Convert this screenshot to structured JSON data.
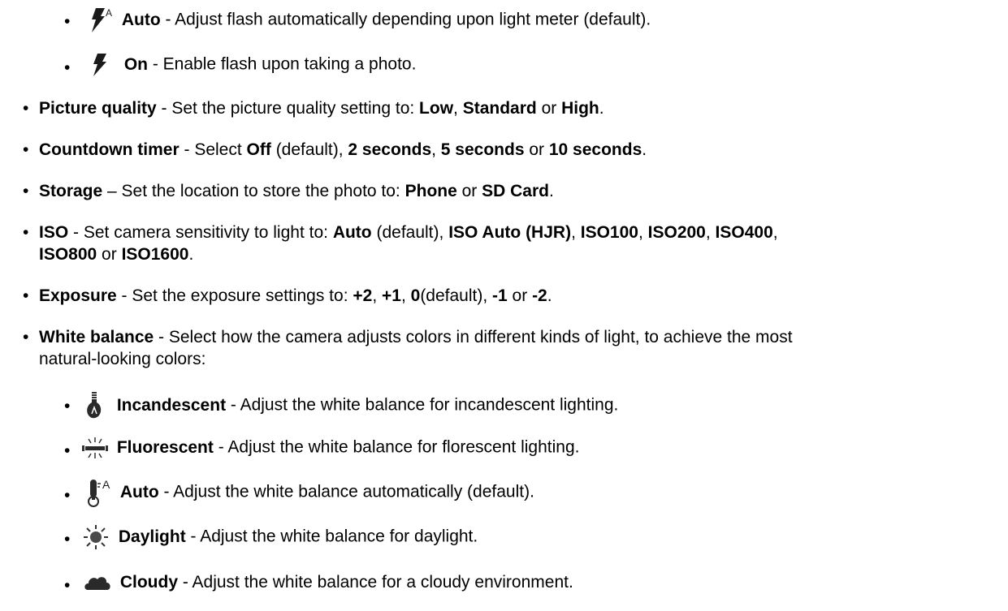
{
  "bullet_char": "•",
  "flash_sub": [
    {
      "icon": "flash-auto-icon",
      "term": "Auto",
      "desc": " - Adjust flash automatically depending upon light meter (default)."
    },
    {
      "icon": "flash-on-icon",
      "term": "On",
      "desc": " - Enable flash upon taking a photo."
    }
  ],
  "picture_quality": {
    "term": "Picture quality",
    "pre": " - Set the picture quality setting to: ",
    "opt1": "Low",
    "sep1": ", ",
    "opt2": "Standard",
    "sep2": " or ",
    "opt3": "High",
    "end": "."
  },
  "countdown_timer": {
    "term": "Countdown timer",
    "pre": " - Select ",
    "opt1": "Off",
    "after1": " (default), ",
    "opt2": "2 seconds",
    "sep2": ", ",
    "opt3": "5 seconds",
    "sep3": " or ",
    "opt4": "10 seconds",
    "end": "."
  },
  "storage": {
    "term": "Storage",
    "pre": " – Set the location to store the photo to: ",
    "opt1": "Phone",
    "sep1": " or ",
    "opt2": "SD Card",
    "end": "."
  },
  "iso": {
    "term": "ISO",
    "pre": " - Set camera sensitivity to light to: ",
    "opt1": "Auto",
    "after1": " (default), ",
    "opt2": "ISO Auto (HJR)",
    "sep2": ", ",
    "opt3": "ISO100",
    "sep3": ", ",
    "opt4": "ISO200",
    "sep4": ", ",
    "opt5": "ISO400",
    "sep5": ",",
    "opt6": "ISO800",
    "sep6": " or ",
    "opt7": "ISO1600",
    "end": "."
  },
  "exposure": {
    "term": "Exposure",
    "pre": " - Set the exposure settings to: ",
    "opt1": "+2",
    "sep1": ", ",
    "opt2": "+1",
    "sep2": ", ",
    "opt3": "0",
    "after3": "(default), ",
    "opt4": "-1",
    "sep4": " or ",
    "opt5": "-2",
    "end": "."
  },
  "white_balance": {
    "term": "White balance",
    "desc_line1": " - Select how the camera adjusts colors in different kinds of light, to achieve the most",
    "desc_line2": "natural-looking colors:"
  },
  "wb_sub": [
    {
      "icon": "incandescent-icon",
      "term": "Incandescent",
      "desc": " - Adjust the white balance for incandescent lighting."
    },
    {
      "icon": "fluorescent-icon",
      "term": "Fluorescent",
      "desc": " - Adjust the white balance for florescent lighting."
    },
    {
      "icon": "wb-auto-icon",
      "term": "Auto",
      "desc": " - Adjust the white balance automatically (default)."
    },
    {
      "icon": "daylight-icon",
      "term": "Daylight",
      "desc": " - Adjust the white balance for daylight."
    },
    {
      "icon": "cloudy-icon",
      "term": "Cloudy",
      "desc": " - Adjust the white balance for a cloudy environment."
    }
  ]
}
